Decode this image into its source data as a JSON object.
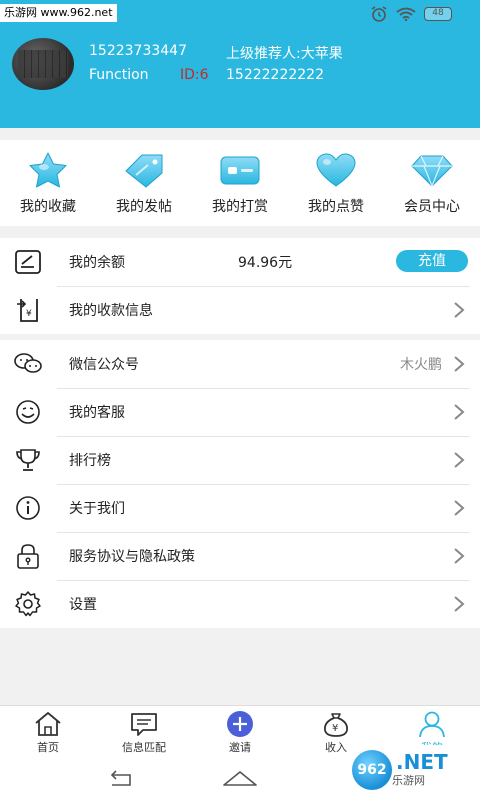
{
  "watermark": "乐游网 www.962.net",
  "status": {
    "battery": "48"
  },
  "user": {
    "phone": "15223733447",
    "referrer": "上级推荐人:大苹果",
    "nickname": "Function",
    "id": "ID:6",
    "referrer_phone": "15222222222"
  },
  "shortcuts": [
    {
      "label": "我的收藏",
      "icon": "star-icon"
    },
    {
      "label": "我的发帖",
      "icon": "tag-icon"
    },
    {
      "label": "我的打赏",
      "icon": "card-icon"
    },
    {
      "label": "我的点赞",
      "icon": "heart-icon"
    },
    {
      "label": "会员中心",
      "icon": "diamond-icon"
    }
  ],
  "wallet": {
    "balance_label": "我的余额",
    "balance_value": "94.96元",
    "recharge_label": "充值",
    "receipt_label": "我的收款信息"
  },
  "menu": [
    {
      "label": "微信公众号",
      "value": "木火鹏",
      "icon": "wechat-icon"
    },
    {
      "label": "我的客服",
      "value": "",
      "icon": "smile-icon"
    },
    {
      "label": "排行榜",
      "value": "",
      "icon": "trophy-icon"
    },
    {
      "label": "关于我们",
      "value": "",
      "icon": "info-icon"
    },
    {
      "label": "服务协议与隐私政策",
      "value": "",
      "icon": "lock-icon"
    },
    {
      "label": "设置",
      "value": "",
      "icon": "gear-icon"
    }
  ],
  "nav": [
    {
      "label": "首页",
      "icon": "home-icon"
    },
    {
      "label": "信息匹配",
      "icon": "message-icon"
    },
    {
      "label": "邀请",
      "icon": "plus-icon"
    },
    {
      "label": "收入",
      "icon": "money-bag-icon"
    },
    {
      "label": "我的",
      "icon": "person-icon"
    }
  ],
  "badge_962": {
    "ball": "962",
    "net": ".NET",
    "site": "乐游网"
  },
  "colors": {
    "accent": "#2ab7e0",
    "id_red": "#c62828"
  }
}
